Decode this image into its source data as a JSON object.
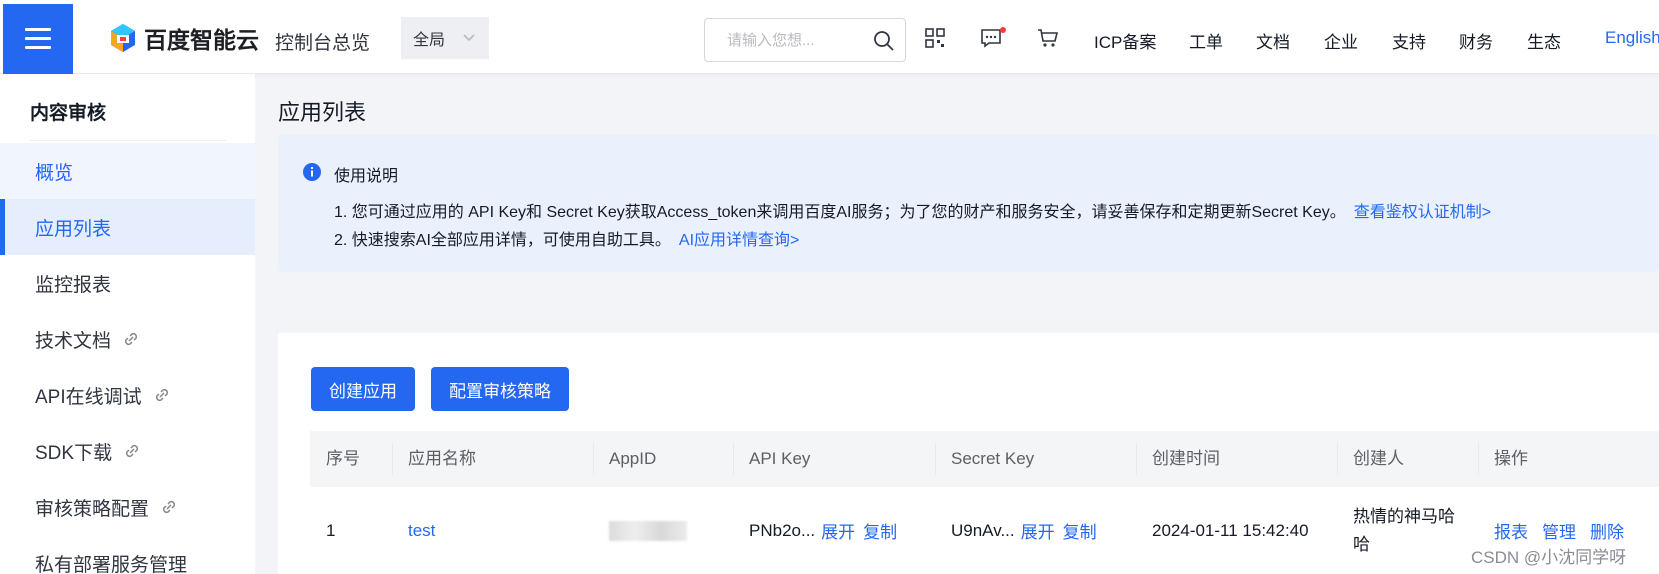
{
  "header": {
    "brand": "百度智能云",
    "console": "控制台总览",
    "region": "全局",
    "search_placeholder": "请输入您想...",
    "nav": [
      "ICP备案",
      "工单",
      "文档",
      "企业",
      "支持",
      "财务",
      "生态"
    ],
    "language": "English"
  },
  "sidebar": {
    "title": "内容审核",
    "items": [
      {
        "label": "概览"
      },
      {
        "label": "应用列表"
      },
      {
        "label": "监控报表"
      },
      {
        "label": "技术文档"
      },
      {
        "label": "API在线调试"
      },
      {
        "label": "SDK下载"
      },
      {
        "label": "审核策略配置"
      },
      {
        "label": "私有部署服务管理"
      }
    ]
  },
  "main": {
    "title": "应用列表",
    "notice": {
      "title": "使用说明",
      "line1": "1. 您可通过应用的 API Key和 Secret Key获取Access_token来调用百度AI服务；为了您的财产和服务安全，请妥善保存和定期更新Secret Key。",
      "line1_link": "查看鉴权认证机制>",
      "line2": "2. 快速搜索AI全部应用详情，可使用自助工具。",
      "line2_link": "AI应用详情查询>"
    },
    "buttons": {
      "create": "创建应用",
      "policy": "配置审核策略"
    },
    "table": {
      "columns": [
        "序号",
        "应用名称",
        "AppID",
        "API Key",
        "Secret Key",
        "创建时间",
        "创建人",
        "操作"
      ],
      "rows": [
        {
          "index": "1",
          "name": "test",
          "appid": "",
          "api_key": "PNb2o...",
          "secret_key": "U9nAv...",
          "expand": "展开",
          "copy": "复制",
          "created": "2024-01-11 15:42:40",
          "creator": "热情的神马哈哈",
          "ops": [
            "报表",
            "管理",
            "删除"
          ]
        }
      ]
    }
  },
  "watermark": "CSDN @小沈同学呀",
  "colors": {
    "primary": "#2468f2",
    "notice_bg": "#eaf1fd",
    "table_head_bg": "#f4f5f7"
  }
}
